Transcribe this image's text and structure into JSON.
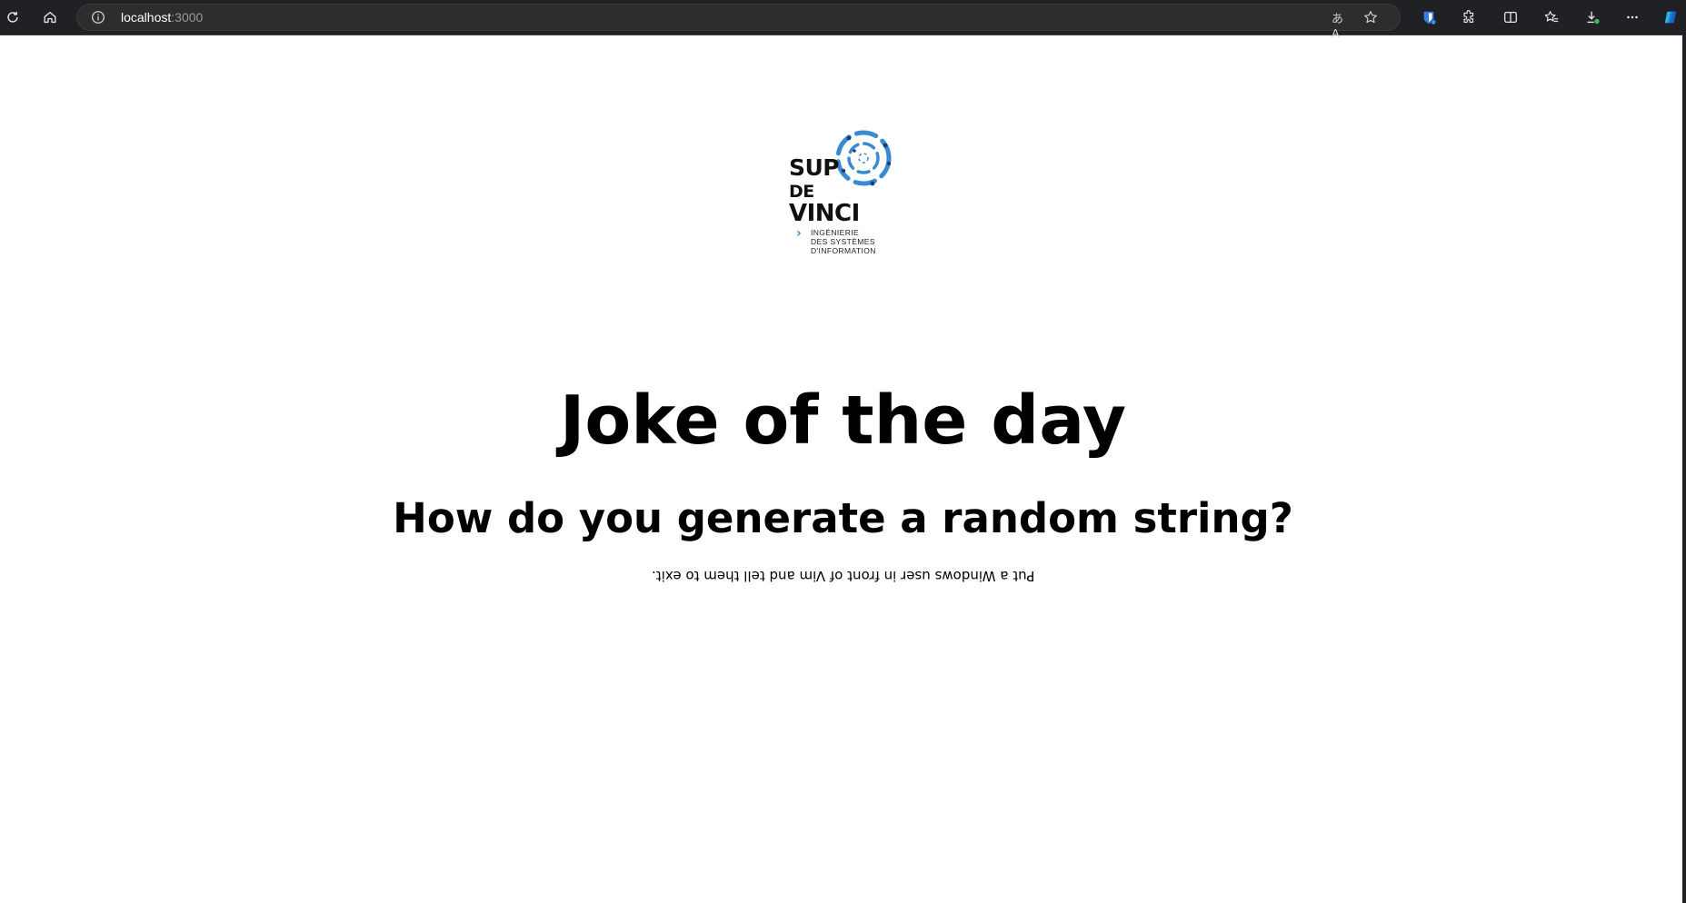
{
  "browser": {
    "url_host": "localhost",
    "url_port": ":3000",
    "translate_glyph": "あA",
    "toolbar_icons": [
      "refresh-icon",
      "home-icon",
      "site-info-icon",
      "translate-icon",
      "favorite-star-icon",
      "bitwarden-icon",
      "extensions-icon",
      "split-screen-icon",
      "favorites-icon",
      "downloads-icon",
      "more-icon",
      "copilot-icon"
    ],
    "bitwarden_badge": "1"
  },
  "logo": {
    "line1": "SUP",
    "line2": "DE",
    "line3": "VINCI",
    "tagline1": "INGÉNIERIE",
    "tagline2": "DES SYSTÈMES",
    "tagline3": "D'INFORMATION",
    "accent": "#3a8ad3"
  },
  "page": {
    "title": "Joke of the day",
    "question": "How do you generate a random string?",
    "answer": "Put a Windows user in front of Vim and tell them to exit."
  }
}
